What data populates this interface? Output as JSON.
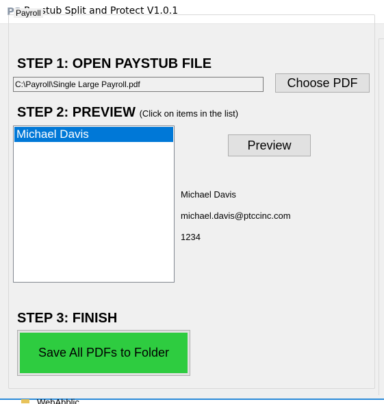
{
  "window": {
    "icon_text": "PS",
    "title": "Paystub Split and Protect V1.0.1"
  },
  "groupbox": {
    "legend": "Payroll"
  },
  "step1": {
    "heading": "STEP 1: OPEN PAYSTUB FILE",
    "file_path": "C:\\Payroll\\Single Large Payroll.pdf",
    "choose_button": "Choose PDF"
  },
  "step2": {
    "heading": "STEP 2: PREVIEW",
    "note": "(Click on items in the list)",
    "list_items": [
      "Michael Davis"
    ],
    "selected_index": 0,
    "preview_button": "Preview",
    "details": {
      "name": "Michael Davis",
      "email": "michael.davis@ptccinc.com",
      "id": "1234"
    }
  },
  "step3": {
    "heading": "STEP 3: FINISH",
    "save_button": "Save All PDFs to Folder",
    "save_button_color": "#2ecc40"
  },
  "background_window": {
    "label": "WebAbblic"
  },
  "colors": {
    "selection": "#0078d7",
    "window_bg": "#f0f0f0"
  }
}
